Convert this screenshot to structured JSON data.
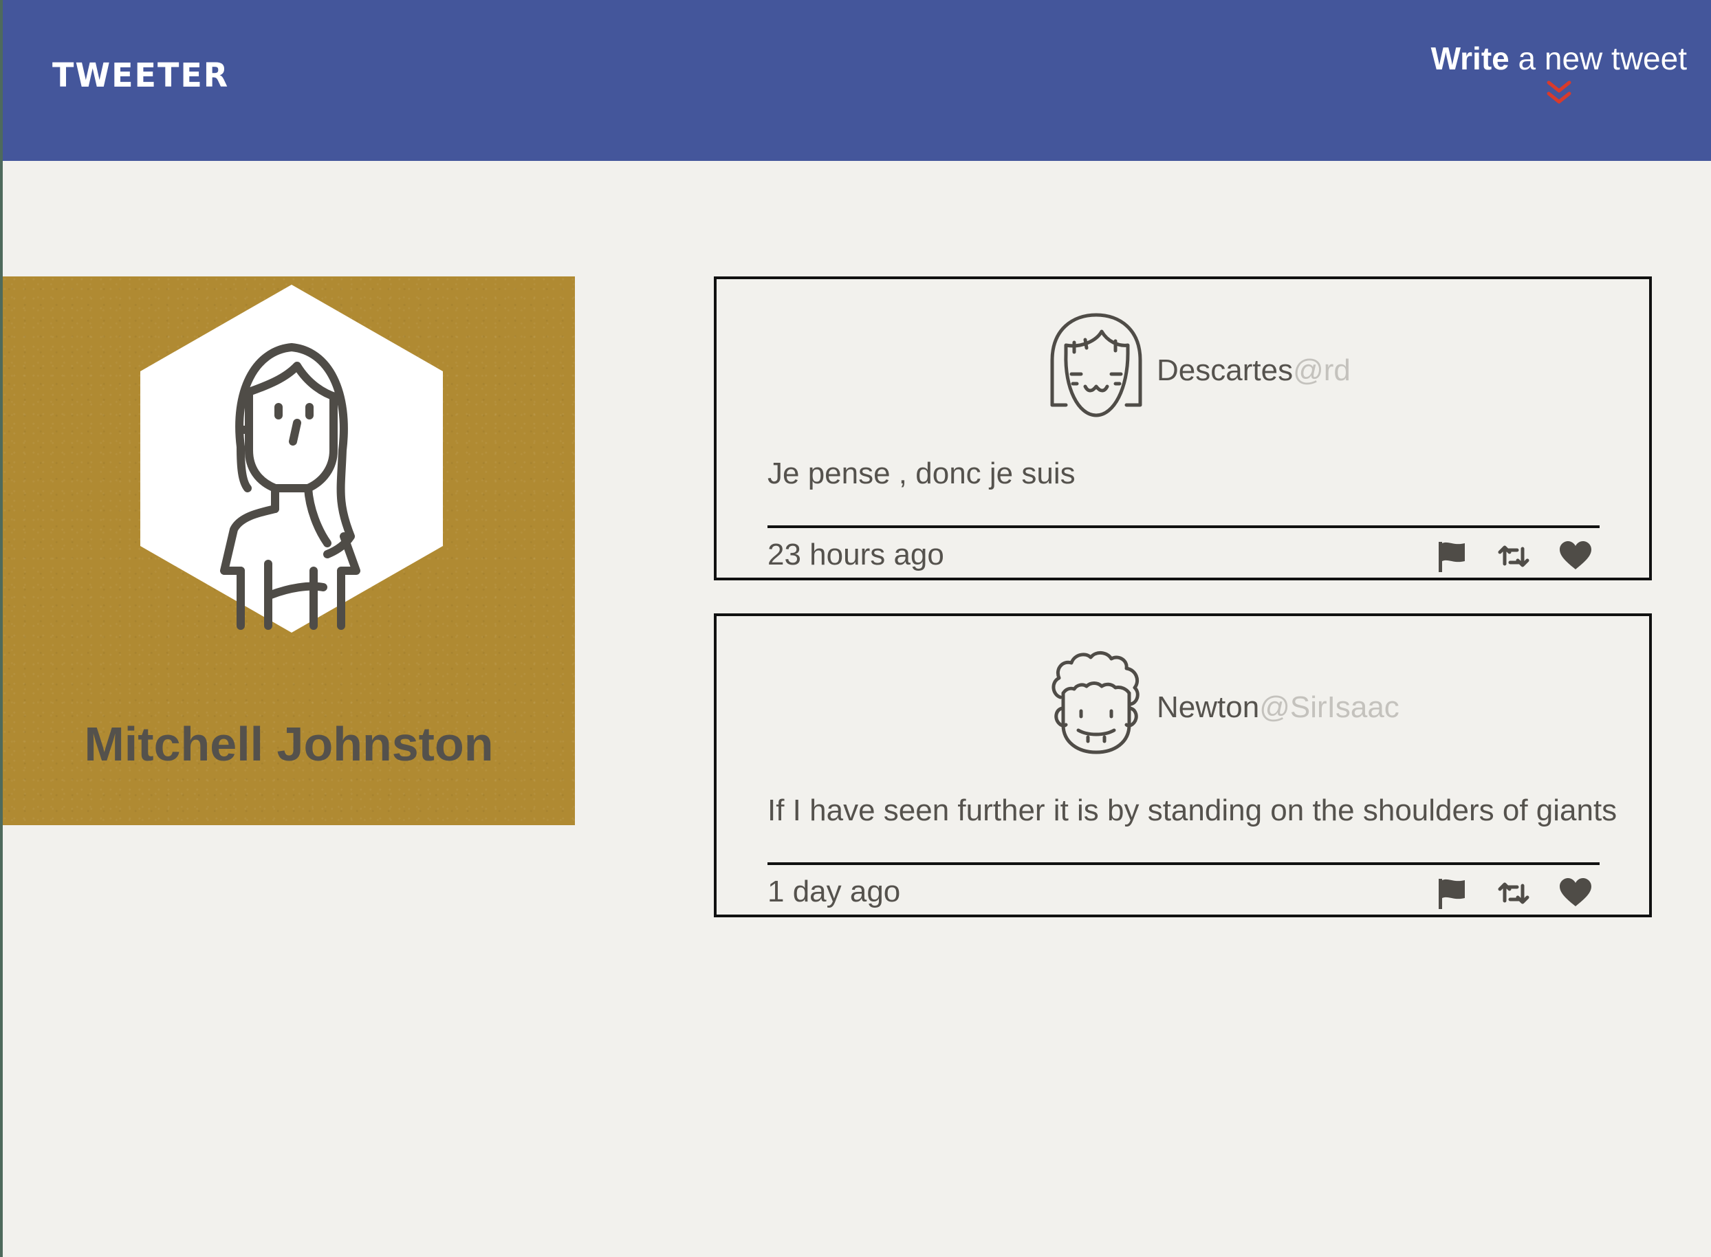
{
  "nav": {
    "brand": "TWEETER",
    "compose_strong": "Write",
    "compose_rest": " a new tweet",
    "compose_icon": "double-chevron-down-icon",
    "compose_icon_color": "#d93a2b"
  },
  "colors": {
    "navbar": "#44569b",
    "profile_bg": "#b08a32",
    "page_bg": "#f2f1ed",
    "text": "#55524d"
  },
  "profile": {
    "name": "Mitchell Johnston",
    "avatar_icon": "woman-avatar-icon"
  },
  "tweets": [
    {
      "author": "Descartes",
      "handle": "@rd",
      "avatar_icon": "girl-face-avatar-icon",
      "text": "Je pense , donc je suis",
      "time": "23 hours ago"
    },
    {
      "author": "Newton",
      "handle": "@SirIsaac",
      "avatar_icon": "curly-hair-face-avatar-icon",
      "text": "If I have seen further it is by standing on the shoulders of giants",
      "time": "1 day ago"
    }
  ],
  "actions": [
    "flag-icon",
    "retweet-icon",
    "heart-icon"
  ]
}
